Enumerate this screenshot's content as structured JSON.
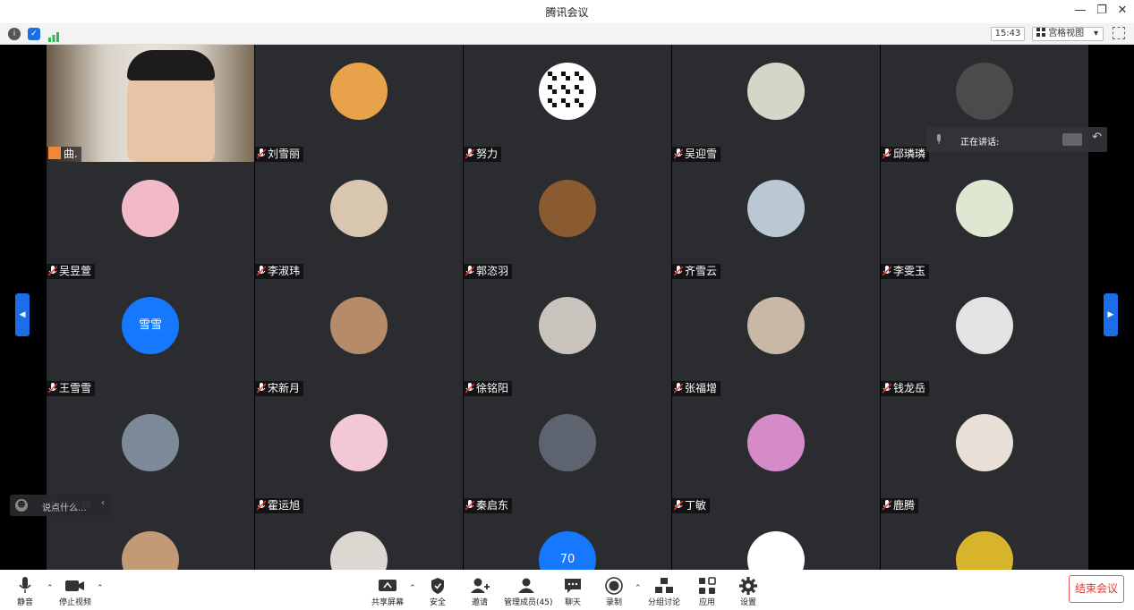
{
  "window": {
    "title": "腾讯会议"
  },
  "subbar": {
    "time": "15:43",
    "view_label": "宫格视图",
    "view_caret": "▾"
  },
  "speaking": {
    "label": "正在讲话:"
  },
  "chat": {
    "placeholder": "说点什么..."
  },
  "colors": {
    "tile_bg": "#2b2c30",
    "accent": "#1a6fe8",
    "end_red": "#e33333"
  },
  "participants": [
    {
      "name": "曲.",
      "type": "video"
    },
    {
      "name": "刘雪丽",
      "type": "photo",
      "color": "#e8a34a"
    },
    {
      "name": "努力",
      "type": "qr"
    },
    {
      "name": "吴迎雪",
      "type": "plain",
      "color": "#d4d6c8"
    },
    {
      "name": "邱璘璘",
      "type": "photo",
      "color": "#4b4b4b"
    },
    {
      "name": "吴昱萱",
      "type": "photo",
      "color": "#f2b9c7"
    },
    {
      "name": "李淑玮",
      "type": "photo",
      "color": "#d9c6b0"
    },
    {
      "name": "郭恣羽",
      "type": "photo",
      "color": "#8a5a30"
    },
    {
      "name": "齐雪云",
      "type": "photo",
      "color": "#b9c8d2"
    },
    {
      "name": "李雯玉",
      "type": "photo",
      "color": "#dfe7d2"
    },
    {
      "name": "王雪雪",
      "type": "text",
      "text": "雪雪",
      "color": "#1677ff"
    },
    {
      "name": "宋新月",
      "type": "photo",
      "color": "#b58b6a"
    },
    {
      "name": "徐铭阳",
      "type": "photo",
      "color": "#c8c4bd"
    },
    {
      "name": "张福增",
      "type": "photo",
      "color": "#c8b8a5"
    },
    {
      "name": "钱龙岳",
      "type": "photo",
      "color": "#e3e3e3"
    },
    {
      "name": "樊兆尊",
      "type": "photo",
      "color": "#7c8a99"
    },
    {
      "name": "霍运旭",
      "type": "photo",
      "color": "#f1c8d4"
    },
    {
      "name": "秦启东",
      "type": "photo",
      "color": "#5d6470"
    },
    {
      "name": "丁敏",
      "type": "photo",
      "color": "#d58bc7"
    },
    {
      "name": "鹿腾",
      "type": "photo",
      "color": "#e8e0d6"
    },
    {
      "name": "",
      "type": "photo",
      "color": "#c39a76"
    },
    {
      "name": "",
      "type": "photo",
      "color": "#dcd7d1"
    },
    {
      "name": "",
      "type": "text",
      "text": "70",
      "color": "#1677ff"
    },
    {
      "name": "",
      "type": "photo",
      "color": "#ffffff"
    },
    {
      "name": "",
      "type": "photo",
      "color": "#d8b32c"
    }
  ],
  "toolbar": {
    "mute": "静音",
    "stop_video": "停止视频",
    "share": "共享屏幕",
    "security": "安全",
    "invite": "邀请",
    "members": "管理成员(45)",
    "chat": "聊天",
    "record": "录制",
    "breakout": "分组讨论",
    "apps": "应用",
    "settings": "设置",
    "end": "结束会议"
  }
}
